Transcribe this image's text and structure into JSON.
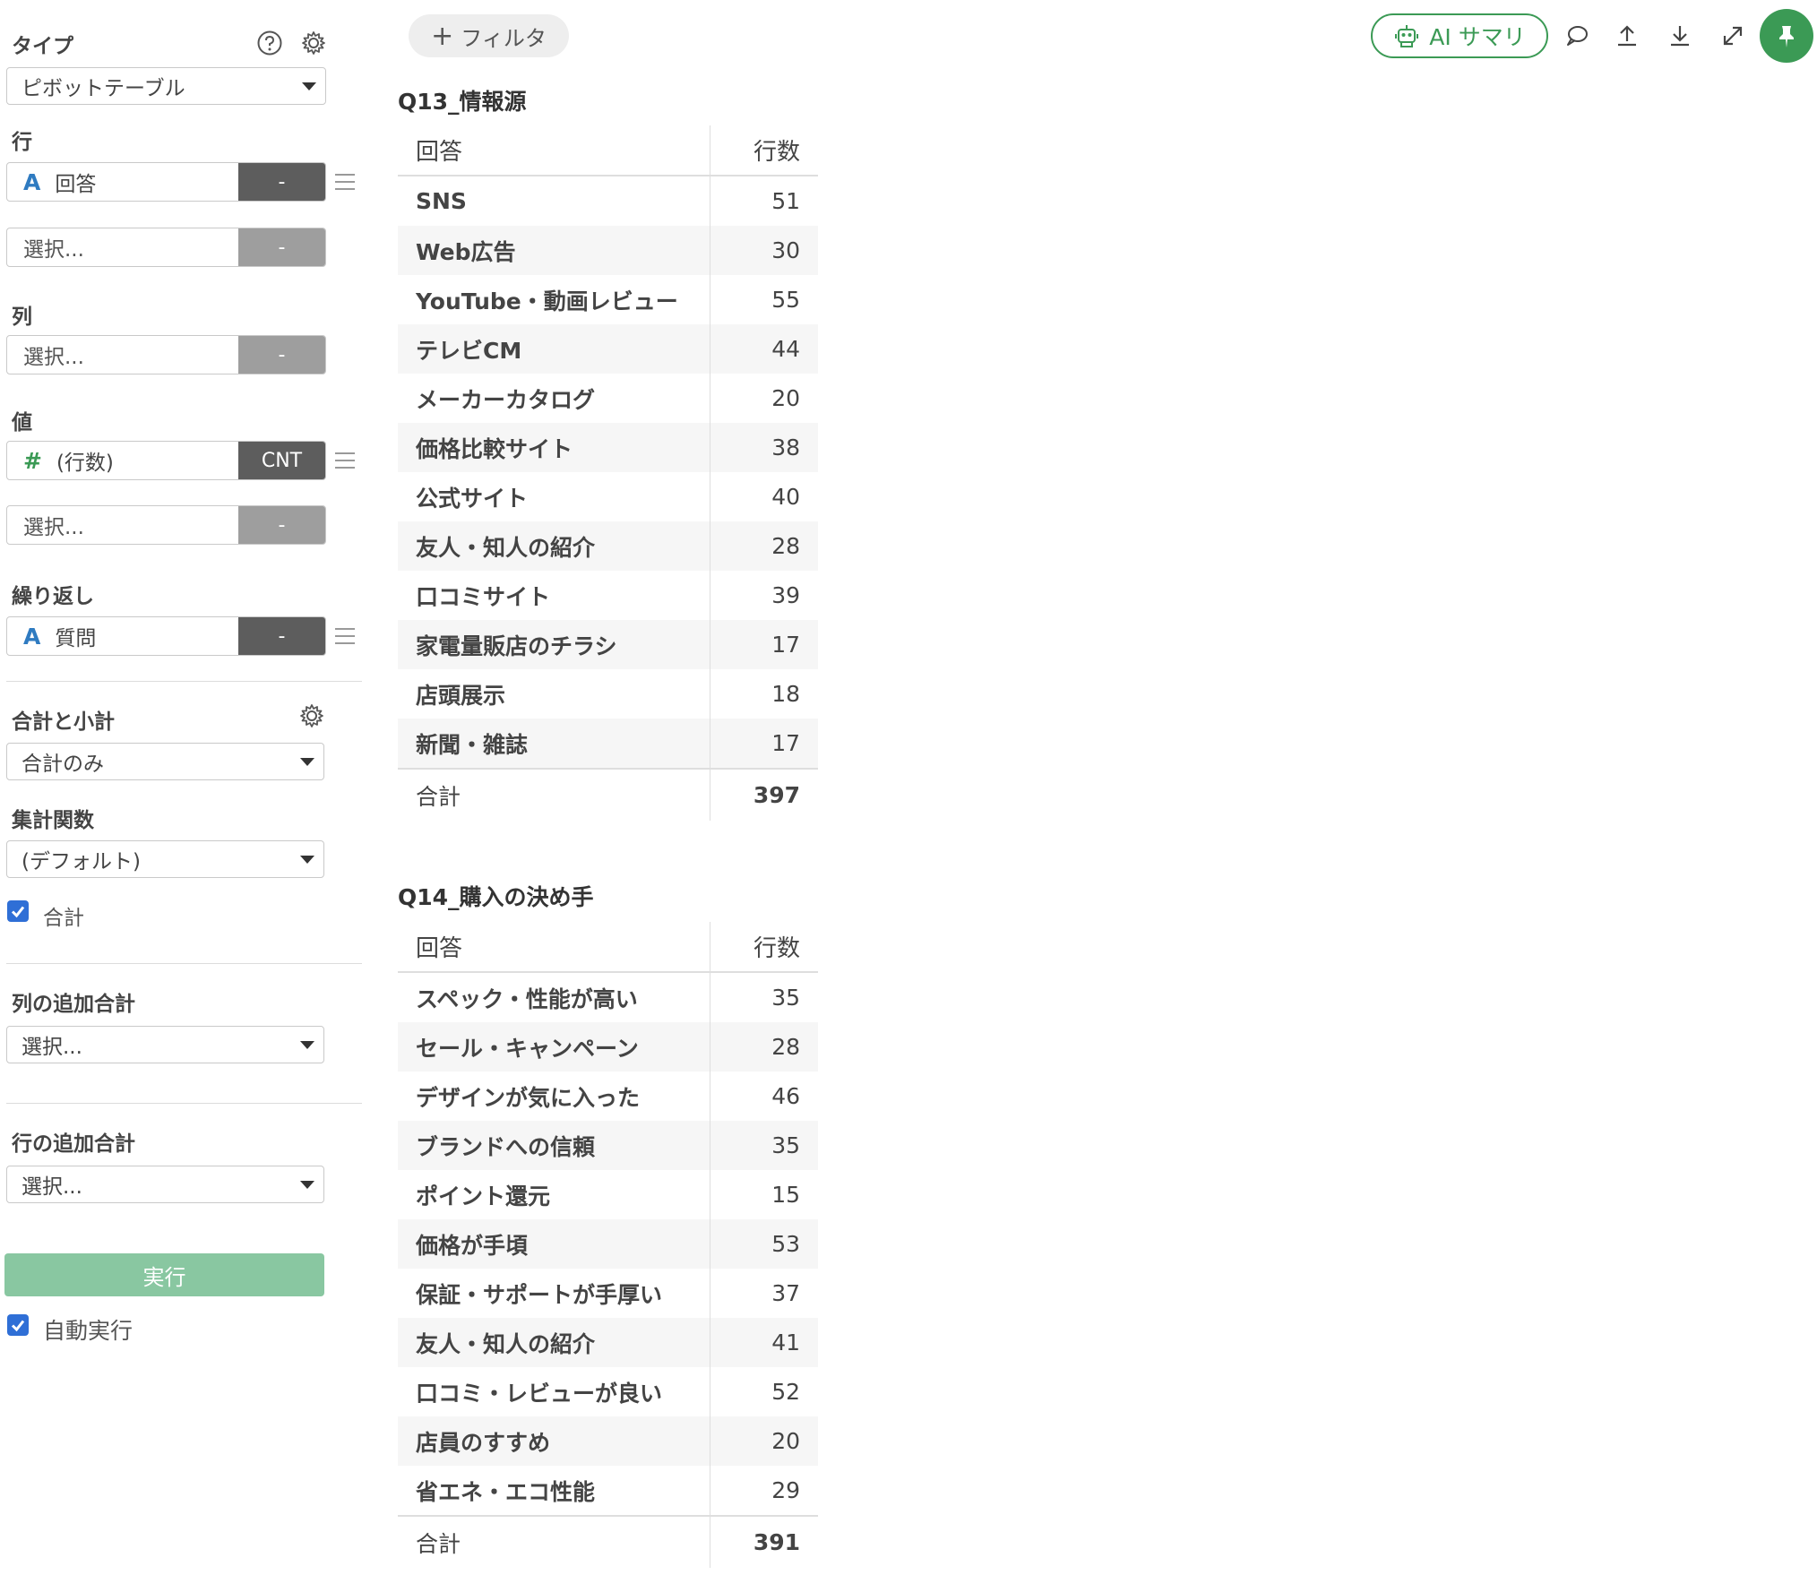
{
  "sidebar": {
    "type_label": "タイプ",
    "type_value": "ピボットテーブル",
    "rows_label": "行",
    "rows": [
      {
        "name": "回答",
        "type": "A",
        "agg": "-"
      }
    ],
    "select_placeholder": "選択...",
    "dash": "-",
    "columns_label": "列",
    "values_label": "値",
    "values": [
      {
        "name": "(行数)",
        "type": "#",
        "agg": "CNT"
      }
    ],
    "repeat_label": "繰り返し",
    "repeat": [
      {
        "name": "質問",
        "type": "A",
        "agg": "-"
      }
    ],
    "totals_label": "合計と小計",
    "totals_value": "合計のみ",
    "aggfunc_label": "集計関数",
    "aggfunc_value": "(デフォルト)",
    "total_checkbox_label": "合計",
    "col_extra_label": "列の追加合計",
    "col_extra_value": "選択...",
    "row_extra_label": "行の追加合計",
    "row_extra_value": "選択...",
    "run_label": "実行",
    "auto_run_label": "自動実行"
  },
  "toolbar": {
    "filter_plus": "+",
    "filter_label": "フィルタ",
    "ai_label": "AI サマリ"
  },
  "tables": [
    {
      "title": "Q13_情報源",
      "header": [
        "回答",
        "行数"
      ],
      "rows": [
        [
          "SNS",
          "51"
        ],
        [
          "Web広告",
          "30"
        ],
        [
          "YouTube・動画レビュー",
          "55"
        ],
        [
          "テレビCM",
          "44"
        ],
        [
          "メーカーカタログ",
          "20"
        ],
        [
          "価格比較サイト",
          "38"
        ],
        [
          "公式サイト",
          "40"
        ],
        [
          "友人・知人の紹介",
          "28"
        ],
        [
          "口コミサイト",
          "39"
        ],
        [
          "家電量販店のチラシ",
          "17"
        ],
        [
          "店頭展示",
          "18"
        ],
        [
          "新聞・雑誌",
          "17"
        ]
      ],
      "total": [
        "合計",
        "397"
      ]
    },
    {
      "title": "Q14_購入の決め手",
      "header": [
        "回答",
        "行数"
      ],
      "rows": [
        [
          "スペック・性能が高い",
          "35"
        ],
        [
          "セール・キャンペーン",
          "28"
        ],
        [
          "デザインが気に入った",
          "46"
        ],
        [
          "ブランドへの信頼",
          "35"
        ],
        [
          "ポイント還元",
          "15"
        ],
        [
          "価格が手頃",
          "53"
        ],
        [
          "保証・サポートが手厚い",
          "37"
        ],
        [
          "友人・知人の紹介",
          "41"
        ],
        [
          "口コミ・レビューが良い",
          "52"
        ],
        [
          "店員のすすめ",
          "20"
        ],
        [
          "省エネ・エコ性能",
          "29"
        ]
      ],
      "total": [
        "合計",
        "391"
      ]
    }
  ]
}
